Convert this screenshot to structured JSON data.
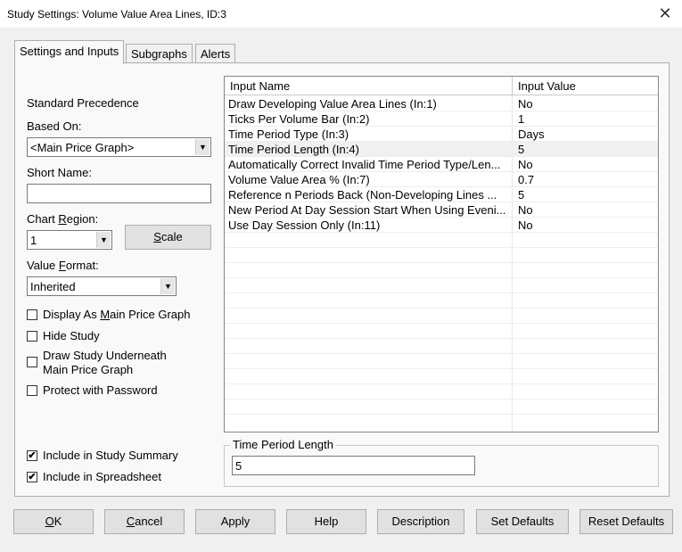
{
  "window": {
    "title": "Study Settings: Volume Value Area Lines, ID:3",
    "close_glyph": "✕"
  },
  "tabs": [
    "Settings and Inputs",
    "Subgraphs",
    "Alerts"
  ],
  "left": {
    "standard_precedence": "Standard Precedence",
    "based_on_label": "Based On:",
    "based_on_value": "<Main Price Graph>",
    "short_name_label": "Short Name:",
    "short_name_value": "",
    "chart_region_label_pre": "Chart ",
    "chart_region_label_u": "R",
    "chart_region_label_post": "egion:",
    "chart_region_value": "1",
    "scale_button_u": "S",
    "scale_button_rest": "cale",
    "value_format_label_pre": "Value ",
    "value_format_label_u": "F",
    "value_format_label_post": "ormat:",
    "value_format_value": "Inherited",
    "checkboxes": [
      {
        "pre": "Display As ",
        "u": "M",
        "post": "ain Price Graph",
        "checked": false
      },
      {
        "label": "Hide Study",
        "checked": false
      },
      {
        "label": "Draw Study Underneath",
        "label2": "Main Price Graph",
        "checked": false
      },
      {
        "label": "Protect with Password",
        "checked": false
      },
      {
        "label": "Include in Study Summary",
        "checked": true
      },
      {
        "label": "Include in Spreadsheet",
        "checked": true
      }
    ]
  },
  "grid": {
    "headers": [
      "Input Name",
      "Input Value"
    ],
    "rows": [
      {
        "name": "Draw Developing Value Area Lines  (In:1)",
        "value": "No"
      },
      {
        "name": "Ticks Per Volume Bar  (In:2)",
        "value": "1"
      },
      {
        "name": "Time Period Type  (In:3)",
        "value": "Days"
      },
      {
        "name": "Time Period Length  (In:4)",
        "value": "5"
      },
      {
        "name": "Automatically Correct Invalid Time Period Type/Len...",
        "value": "No"
      },
      {
        "name": "Volume Value Area %  (In:7)",
        "value": "0.7"
      },
      {
        "name": "Reference n Periods Back (Non-Developing Lines ...",
        "value": "5"
      },
      {
        "name": "New Period At Day Session Start When Using Eveni...",
        "value": "No"
      },
      {
        "name": "Use Day Session Only  (In:11)",
        "value": "No"
      }
    ],
    "selected_index": 3
  },
  "editor": {
    "label": "Time Period Length",
    "value": "5"
  },
  "buttons": {
    "ok_u": "O",
    "ok_rest": "K",
    "cancel_u": "C",
    "cancel_rest": "ancel",
    "apply": "Apply",
    "help": "Help",
    "description": "Description",
    "set_defaults": "Set Defaults",
    "reset_defaults": "Reset Defaults"
  },
  "icons": {
    "dropdown": "chevron-down-icon",
    "check": "✔",
    "arrow_glyph": "▼"
  }
}
